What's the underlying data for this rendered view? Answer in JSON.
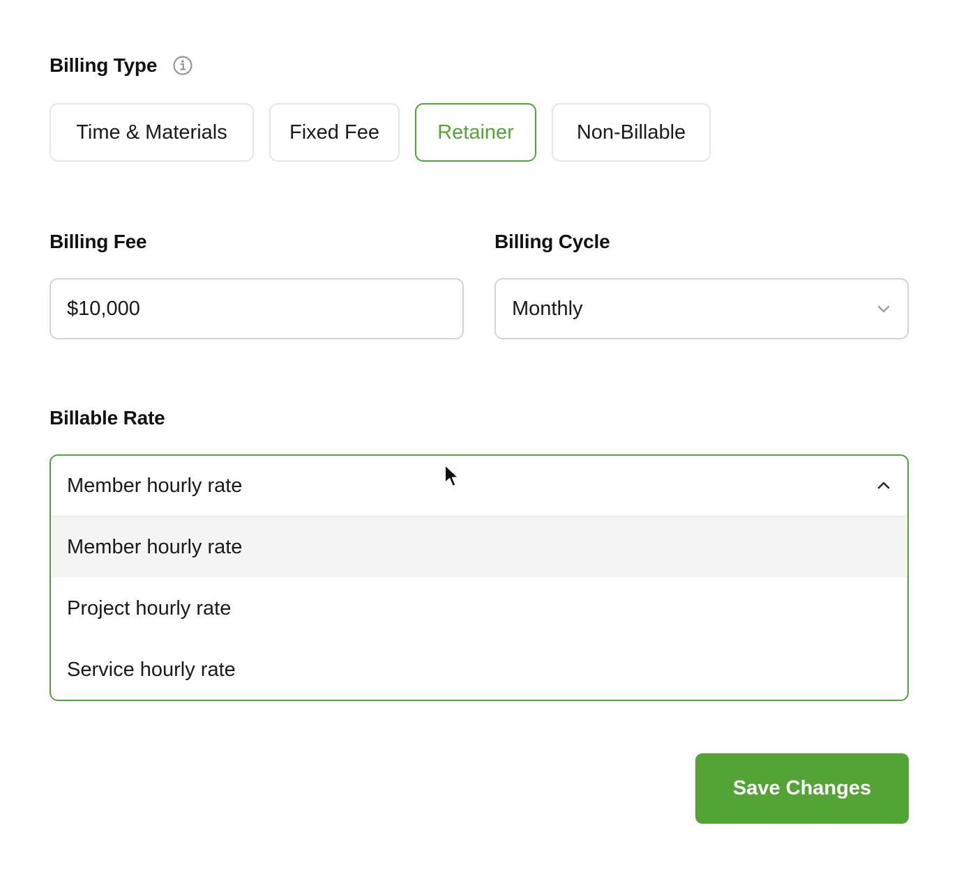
{
  "billing_type": {
    "label": "Billing Type",
    "info_icon": "info-icon",
    "options": [
      {
        "label": "Time & Materials",
        "selected": false
      },
      {
        "label": "Fixed Fee",
        "selected": false
      },
      {
        "label": "Retainer",
        "selected": true
      },
      {
        "label": "Non-Billable",
        "selected": false
      }
    ]
  },
  "billing_fee": {
    "label": "Billing Fee",
    "value": "$10,000"
  },
  "billing_cycle": {
    "label": "Billing Cycle",
    "value": "Monthly",
    "icon": "chevron-down-icon"
  },
  "billable_rate": {
    "label": "Billable Rate",
    "selected": "Member hourly rate",
    "icon": "chevron-up-icon",
    "options": [
      {
        "label": "Member hourly rate",
        "highlighted": true
      },
      {
        "label": "Project hourly rate",
        "highlighted": false
      },
      {
        "label": "Service hourly rate",
        "highlighted": false
      }
    ]
  },
  "actions": {
    "save_label": "Save Changes"
  },
  "colors": {
    "accent": "#52a535",
    "border": "#d4d4d4",
    "hover_bg": "#f4f4f4",
    "text": "#1a1a1a"
  }
}
